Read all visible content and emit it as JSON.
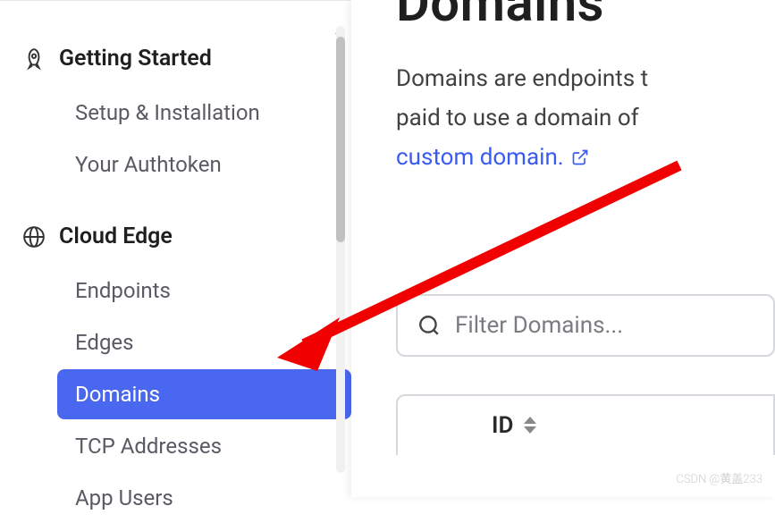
{
  "sidebar": {
    "sections": [
      {
        "title": "Getting Started",
        "items": [
          {
            "label": "Setup & Installation"
          },
          {
            "label": "Your Authtoken"
          }
        ]
      },
      {
        "title": "Cloud Edge",
        "items": [
          {
            "label": "Endpoints"
          },
          {
            "label": "Edges"
          },
          {
            "label": "Domains",
            "active": true
          },
          {
            "label": "TCP Addresses"
          },
          {
            "label": "App Users"
          }
        ]
      }
    ]
  },
  "main": {
    "title": "Domains",
    "description_part1": "Domains are endpoints t",
    "description_part2": "paid to use a domain of ",
    "link_text": "custom domain."
  },
  "filter": {
    "placeholder": "Filter Domains..."
  },
  "table": {
    "columns": [
      {
        "label": "ID"
      }
    ]
  },
  "watermark": "CSDN @黄盖233"
}
